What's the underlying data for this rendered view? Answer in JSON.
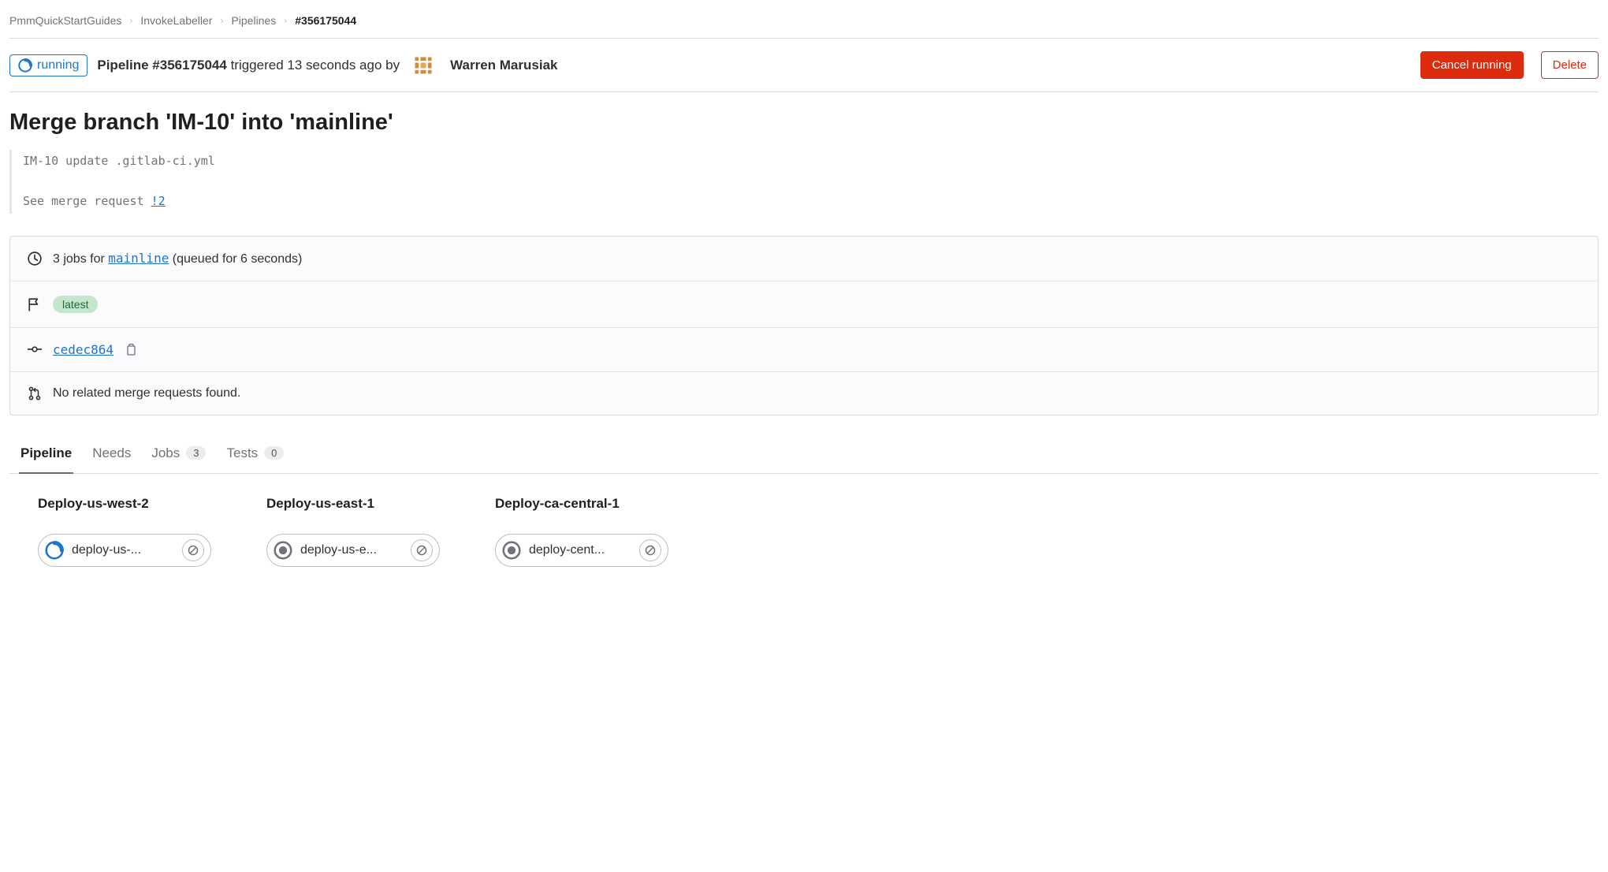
{
  "breadcrumb": {
    "items": [
      "PmmQuickStartGuides",
      "InvokeLabeller",
      "Pipelines"
    ],
    "current": "#356175044"
  },
  "header": {
    "status_label": "running",
    "pipeline_label": "Pipeline ",
    "pipeline_id": "#356175044",
    "triggered_text": " triggered 13 seconds ago by",
    "author_name": "Warren Marusiak",
    "cancel_label": "Cancel running",
    "delete_label": "Delete"
  },
  "commit": {
    "title": "Merge branch 'IM-10' into 'mainline'",
    "body_line1": "IM-10 update .gitlab-ci.yml",
    "body_line2_prefix": "See merge request ",
    "mr_ref": "!2"
  },
  "well": {
    "jobs_text_prefix": "3 jobs for ",
    "branch": "mainline",
    "jobs_text_suffix": " (queued for 6 seconds)",
    "latest_label": "latest",
    "commit_sha": "cedec864",
    "mr_none_text": "No related merge requests found."
  },
  "tabs": {
    "pipeline": "Pipeline",
    "needs": "Needs",
    "jobs": "Jobs",
    "jobs_count": "3",
    "tests": "Tests",
    "tests_count": "0"
  },
  "stages": [
    {
      "name": "Deploy-us-west-2",
      "job": "deploy-us-...",
      "status": "running"
    },
    {
      "name": "Deploy-us-east-1",
      "job": "deploy-us-e...",
      "status": "pending"
    },
    {
      "name": "Deploy-ca-central-1",
      "job": "deploy-cent...",
      "status": "pending"
    }
  ]
}
